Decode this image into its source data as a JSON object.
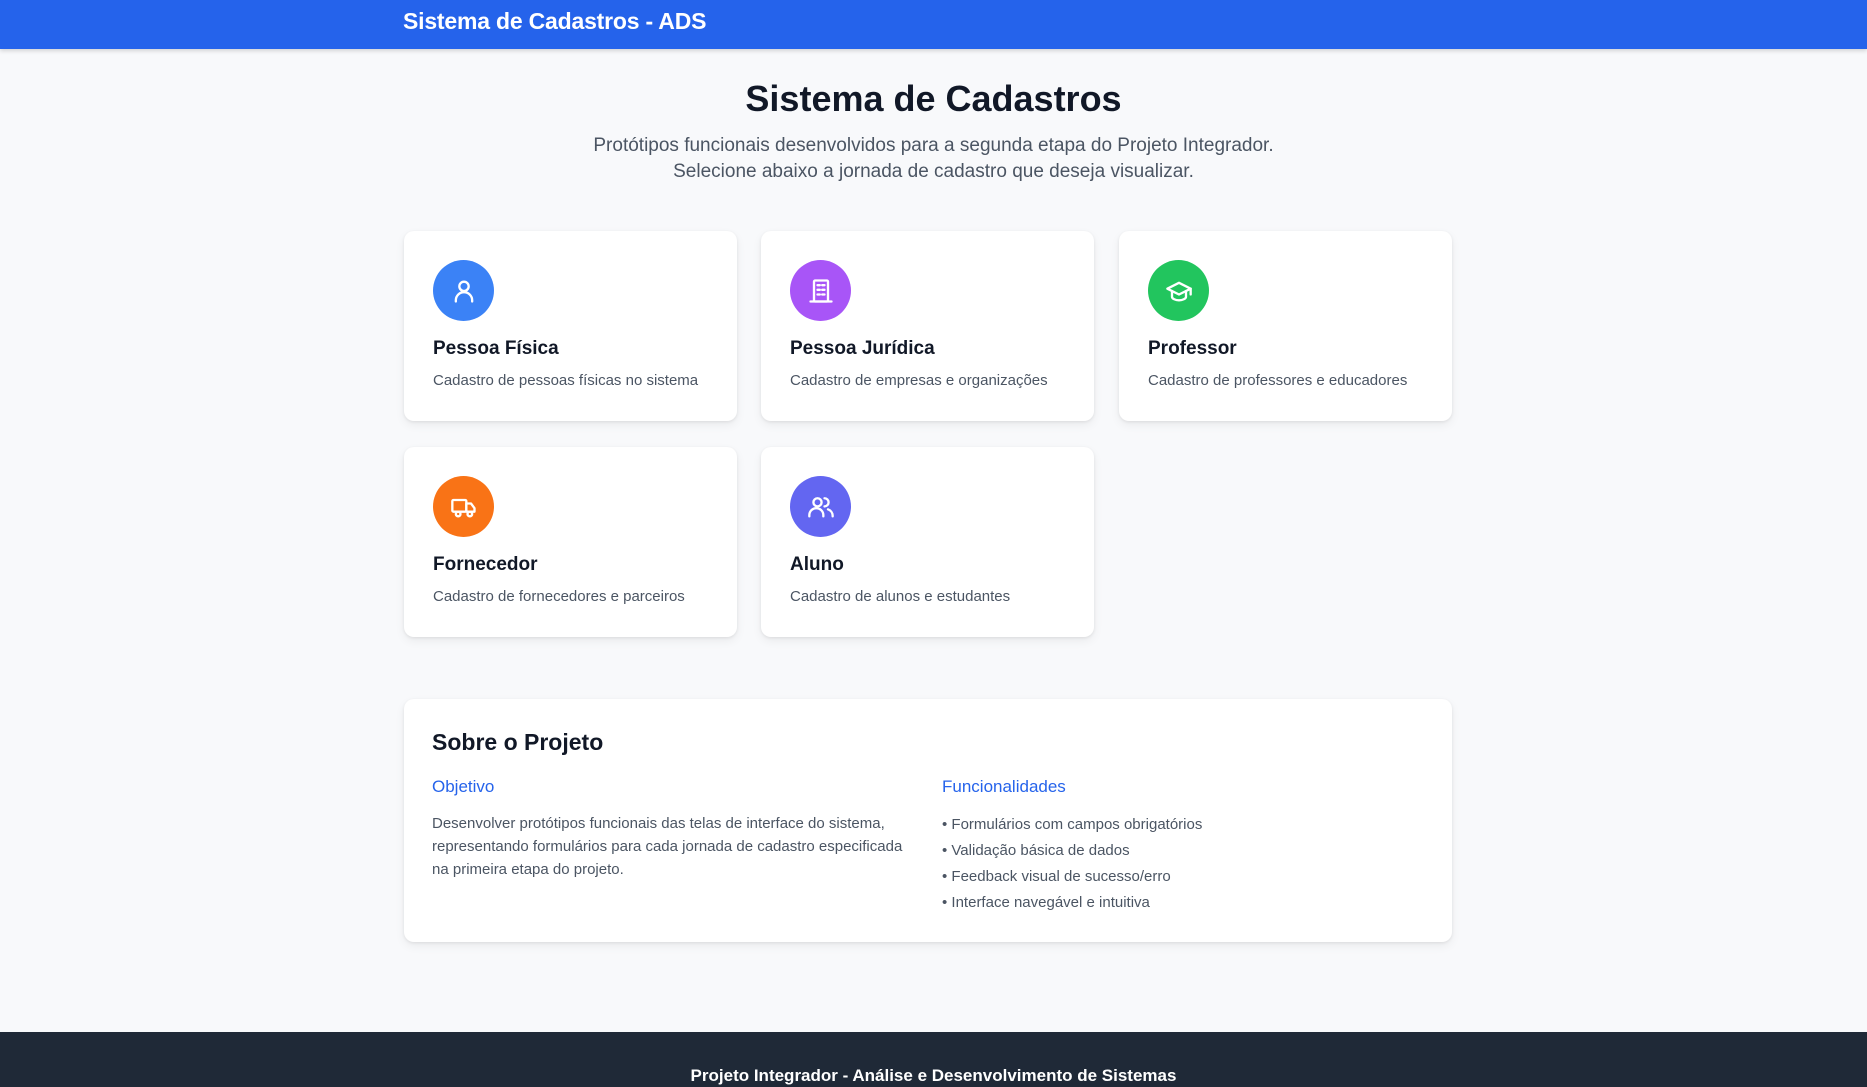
{
  "header": {
    "brand": "Sistema de Cadastros - ADS"
  },
  "hero": {
    "title": "Sistema de Cadastros",
    "subtitle_line1": "Protótipos funcionais desenvolvidos para a segunda etapa do Projeto Integrador.",
    "subtitle_line2": "Selecione abaixo a jornada de cadastro que deseja visualizar."
  },
  "cards": [
    {
      "title": "Pessoa Física",
      "description": "Cadastro de pessoas físicas no sistema",
      "icon": "user-icon",
      "color": "#3b82f6"
    },
    {
      "title": "Pessoa Jurídica",
      "description": "Cadastro de empresas e organizações",
      "icon": "building-icon",
      "color": "#a855f7"
    },
    {
      "title": "Professor",
      "description": "Cadastro de professores e educadores",
      "icon": "graduation-cap-icon",
      "color": "#22c55e"
    },
    {
      "title": "Fornecedor",
      "description": "Cadastro de fornecedores e parceiros",
      "icon": "truck-icon",
      "color": "#f97316"
    },
    {
      "title": "Aluno",
      "description": "Cadastro de alunos e estudantes",
      "icon": "users-icon",
      "color": "#6366f1"
    }
  ],
  "about": {
    "title": "Sobre o Projeto",
    "objective_title": "Objetivo",
    "objective_text": "Desenvolver protótipos funcionais das telas de interface do sistema, representando formulários para cada jornada de cadastro especificada na primeira etapa do projeto.",
    "features_title": "Funcionalidades",
    "features": [
      "• Formulários com campos obrigatórios",
      "• Validação básica de dados",
      "• Feedback visual de sucesso/erro",
      "• Interface navegável e intuitiva"
    ]
  },
  "footer": {
    "text": "Projeto Integrador - Análise e Desenvolvimento de Sistemas"
  },
  "colors": {
    "primary": "#2563eb",
    "footer_bg": "#1f2937",
    "page_bg": "#f8f9fb"
  }
}
